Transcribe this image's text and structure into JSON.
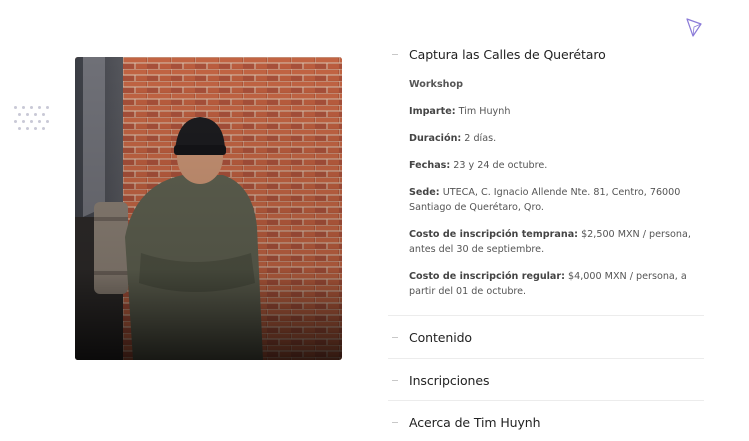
{
  "decor": {
    "dots_icon": "dot-grid-icon",
    "triangle_icon": "triangle-outline-icon",
    "accent": "#8b7bd8"
  },
  "photo": {
    "alt": "Tim Huynh"
  },
  "workshop": {
    "title": "Captura las Calles de Querétaro",
    "type": "Workshop",
    "details": [
      {
        "label": "Imparte:",
        "value": "Tim Huynh"
      },
      {
        "label": "Duración:",
        "value": "2 días."
      },
      {
        "label": "Fechas:",
        "value": "23 y 24 de octubre."
      },
      {
        "label": "Sede:",
        "value": "UTECA, C. Ignacio Allende Nte. 81, Centro, 76000 Santiago de Querétaro, Qro."
      },
      {
        "label": "Costo de inscripción temprana:",
        "value": "$2,500 MXN / persona, antes del 30 de septiembre."
      },
      {
        "label": "Costo de inscripción regular:",
        "value": "$4,000 MXN / persona, a partir del 01 de octubre."
      }
    ]
  },
  "accordion": {
    "items": [
      {
        "label": "Contenido"
      },
      {
        "label": "Inscripciones"
      },
      {
        "label": "Acerca de Tim Huynh"
      }
    ]
  }
}
